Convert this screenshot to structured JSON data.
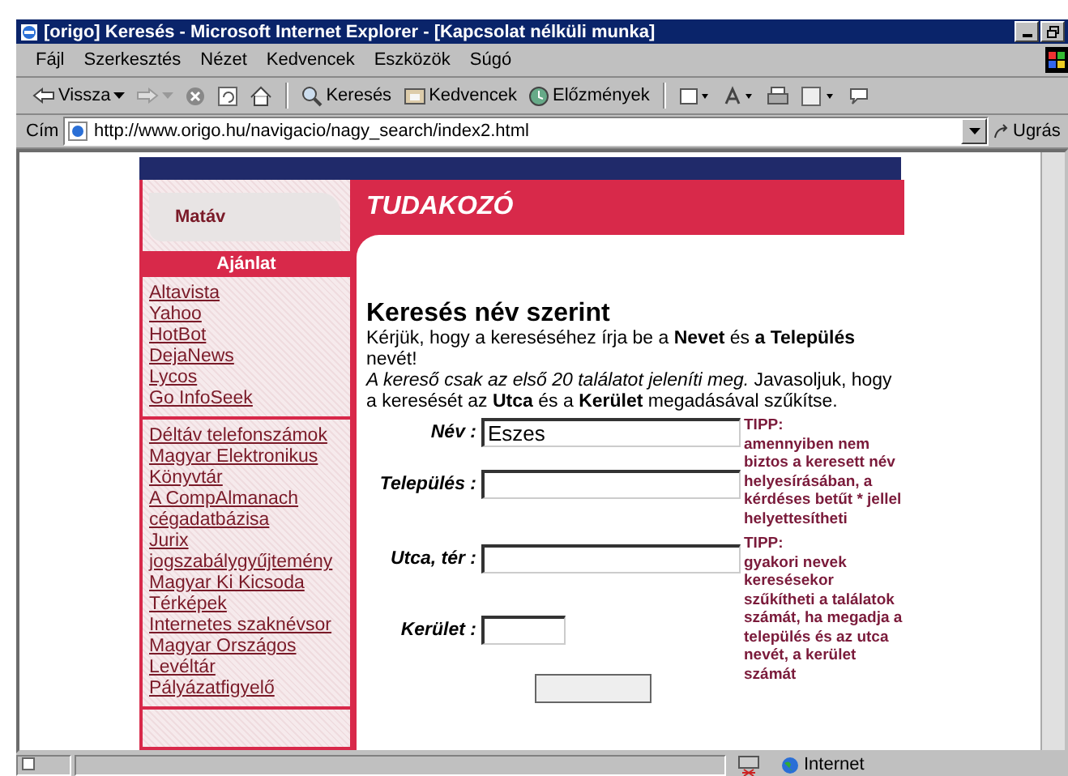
{
  "window": {
    "title": "[origo] Keresés - Microsoft Internet Explorer - [Kapcsolat nélküli munka]"
  },
  "menu": [
    "Fájl",
    "Szerkesztés",
    "Nézet",
    "Kedvencek",
    "Eszközök",
    "Súgó"
  ],
  "toolbar": [
    {
      "kind": "back",
      "label": "Vissza"
    },
    {
      "kind": "forward"
    },
    {
      "kind": "stop"
    },
    {
      "kind": "refresh"
    },
    {
      "kind": "home"
    },
    {
      "kind": "search",
      "label": "Keresés"
    },
    {
      "kind": "favorites",
      "label": "Kedvencek"
    },
    {
      "kind": "history",
      "label": "Előzmények"
    },
    {
      "kind": "mail"
    },
    {
      "kind": "font"
    },
    {
      "kind": "print"
    },
    {
      "kind": "edit"
    },
    {
      "kind": "discuss"
    }
  ],
  "address": {
    "label": "Cím",
    "url": "http://www.origo.hu/navigacio/nagy_search/index2.html",
    "go": "Ugrás"
  },
  "sidebar": {
    "tab": "Matáv",
    "header": "Ajánlat",
    "groups": [
      [
        "Altavista",
        "Yahoo",
        "HotBot",
        "DejaNews",
        "Lycos",
        "Go InfoSeek"
      ],
      [
        "Déltáv telefonszámok",
        "Magyar Elektronikus Könyvtár",
        "A CompAlmanach cégadatbázisa",
        "Jurix jogszabálygyűjtemény",
        "Magyar Ki Kicsoda",
        "Térképek",
        "Internetes szaknévsor",
        "Magyar Országos Levéltár",
        "Pályázatfigyelő"
      ]
    ]
  },
  "main": {
    "title": "TUDAKOZÓ",
    "heading": "Keresés név szerint",
    "paragraphs": [
      "Kérjük, hogy a kereséséhez írja be a **Nevet** és **a Település** nevét!",
      "*A kereső csak az első 20 találatot jeleníti meg.* Javasoljuk, hogy a keresését az **Utca** és a **Kerület** megadásával szűkítse."
    ],
    "fields": [
      {
        "label": "Név :",
        "value": "Eszes",
        "kind": "long"
      },
      {
        "label": "Település :",
        "kind": "long"
      },
      {
        "label": "Utca, tér :",
        "kind": "long"
      },
      {
        "label": "Kerület :",
        "kind": "short"
      }
    ],
    "tips": [
      {
        "title": "TIPP:",
        "text": "amennyiben nem biztos a keresett név helyesírásában, a kérdéses betűt * jellel helyettesítheti"
      },
      {
        "title": "TIPP:",
        "text": "gyakori nevek keresésekor szűkítheti a találatok számát, ha megadja a település és az utca nevét, a kerület számát"
      }
    ]
  },
  "status": {
    "zone": "Internet"
  }
}
